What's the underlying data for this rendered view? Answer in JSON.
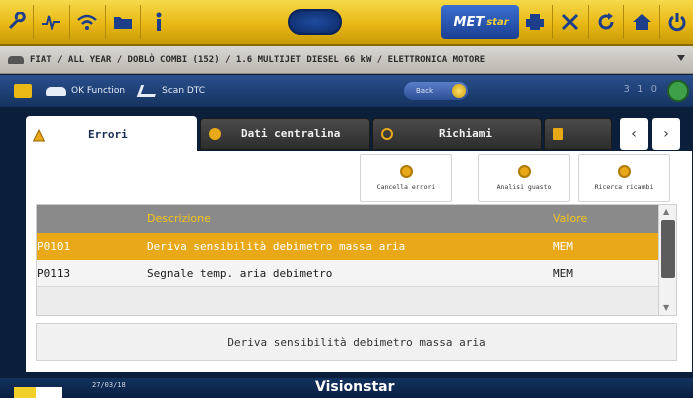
{
  "toolbar": {
    "metstar_label": "MET",
    "metstar_sub": "star"
  },
  "breadcrumb": {
    "path": "FIAT / ALL YEAR / DOBLÒ COMBI (152) / 1.6 MULTIJET DIESEL 66 kW / ELETTRONICA MOTORE"
  },
  "funcbar": {
    "ok_function": "OK Function",
    "scan_dtc": "Scan DTC",
    "back_label": "Back",
    "right_indicator": "3 1 0"
  },
  "tabs": [
    {
      "label": "Errori",
      "active": true
    },
    {
      "label": "Dati centralina",
      "active": false
    },
    {
      "label": "Richiami",
      "active": false
    }
  ],
  "actions": {
    "cancella": "Cancella errori",
    "analisi": "Analisi guasto",
    "ricerca": "Ricerca ricambi"
  },
  "table": {
    "col_desc": "Descrizione",
    "col_valore": "Valore",
    "rows": [
      {
        "code": "P0101",
        "desc": "Deriva sensibilità debimetro massa aria",
        "valore": "MEM",
        "selected": true
      },
      {
        "code": "P0113",
        "desc": "Segnale temp. aria debimetro",
        "valore": "MEM",
        "selected": false
      }
    ]
  },
  "detail": {
    "text": "Deriva sensibilità debimetro massa aria"
  },
  "bottom": {
    "date": "27/03/18",
    "logo": "Visionstar"
  },
  "colors": {
    "accent": "#e8a818",
    "toolbar": "#f0c72a",
    "header_text": "#f5c518"
  }
}
